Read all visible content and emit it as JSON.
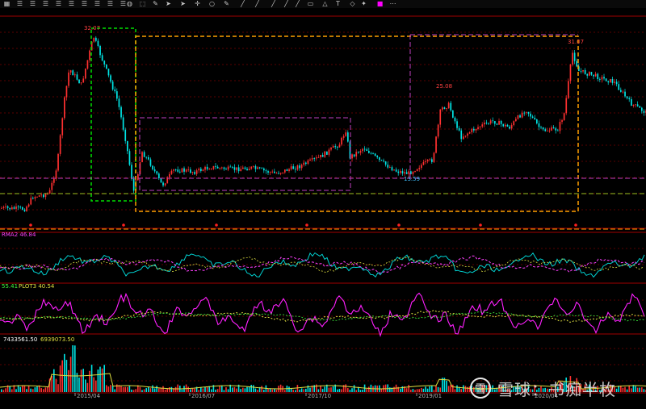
{
  "toolbar": {
    "icons": [
      "grid-icon",
      "list-icon",
      "list-icon",
      "list-icon",
      "list-icon",
      "list-icon",
      "list-icon",
      "list-icon",
      "list-icon",
      "list-icon",
      "globe-icon",
      "select-icon",
      "pen-icon",
      "cursor-icon",
      "cursor-icon",
      "crosshair-icon",
      "circle-icon",
      "pen-icon",
      "line-icon",
      "line-icon",
      "line-icon",
      "line-icon",
      "line-icon",
      "rect-icon",
      "triangle-icon",
      "text-icon",
      "shape-icon",
      "brush-icon",
      "palette-icon",
      "more-icon"
    ],
    "accent": "#ff00ff"
  },
  "colors": {
    "up": "#ff3030",
    "down": "#00e5e5",
    "green_box": "#00e000",
    "orange_box": "#ffa000",
    "magenta_box": "#c040c0",
    "grid": "#5a0000",
    "ma_yellow": "#e0e040",
    "ma_magenta": "#ff40ff"
  },
  "chart_data": {
    "type": "candlestick",
    "price": {
      "annotations": [
        {
          "label": "32.07",
          "kind": "high",
          "x": "2015/06"
        },
        {
          "label": "25.08",
          "kind": "high",
          "x": "2019/03"
        },
        {
          "label": "31.07",
          "kind": "high",
          "x": "2020/04"
        },
        {
          "label": "13.59",
          "kind": "low",
          "x": "2019/01"
        }
      ]
    },
    "indicator1": {
      "name": "RMA2",
      "value": "46.84"
    },
    "indicator2": {
      "prefix_value": "55.41",
      "name": "PLOT3",
      "value": "40.54"
    },
    "volume": {
      "value1": "7433561.50",
      "value2": "6939073.50"
    },
    "xaxis": {
      "ticks": [
        "2015/04",
        "2016/07",
        "2017/10",
        "2019/01",
        "2020/04"
      ]
    }
  },
  "watermark": {
    "logo": "雪",
    "text": "雪球：书痴半枚"
  }
}
